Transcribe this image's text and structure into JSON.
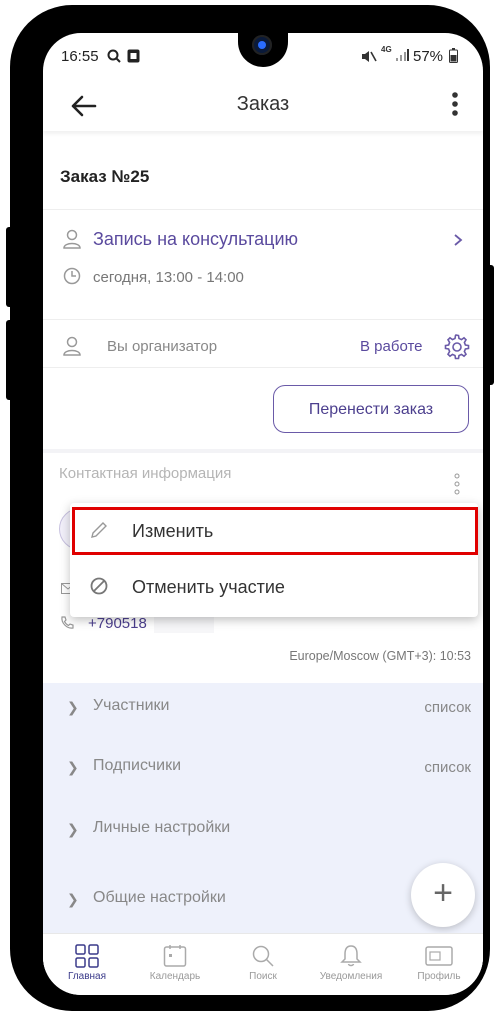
{
  "status_bar": {
    "time": "16:55",
    "network": "4G",
    "battery": "57%"
  },
  "header": {
    "title": "Заказ"
  },
  "order": {
    "title": "Заказ №25",
    "service": "Запись на консультацию",
    "time": "сегодня, 13:00 - 14:00",
    "organizer": "Вы организатор",
    "status": "В работе",
    "reschedule_label": "Перенести заказ"
  },
  "contact": {
    "header": "Контактная информация",
    "phone": "+790518",
    "timezone": "Europe/Moscow (GMT+3): 10:53"
  },
  "context_menu": {
    "items": [
      {
        "label": "Изменить",
        "icon": "pencil-icon"
      },
      {
        "label": "Отменить участие",
        "icon": "cancel-circle-icon"
      }
    ]
  },
  "sections": [
    {
      "label": "Участники",
      "value": "список"
    },
    {
      "label": "Подписчики",
      "value": "список"
    },
    {
      "label": "Личные настройки",
      "value": ""
    },
    {
      "label": "Общие настройки",
      "value": ""
    }
  ],
  "bottom_nav": [
    {
      "label": "Главная",
      "icon": "grid-icon",
      "active": true
    },
    {
      "label": "Календарь",
      "icon": "calendar-icon",
      "active": false
    },
    {
      "label": "Поиск",
      "icon": "search-icon",
      "active": false
    },
    {
      "label": "Уведомления",
      "icon": "bell-icon",
      "active": false
    },
    {
      "label": "Профиль",
      "icon": "profile-card-icon",
      "active": false
    }
  ],
  "colors": {
    "accent": "#5a4a9e",
    "highlight": "#e00000",
    "section_bg": "#eef1fb"
  }
}
